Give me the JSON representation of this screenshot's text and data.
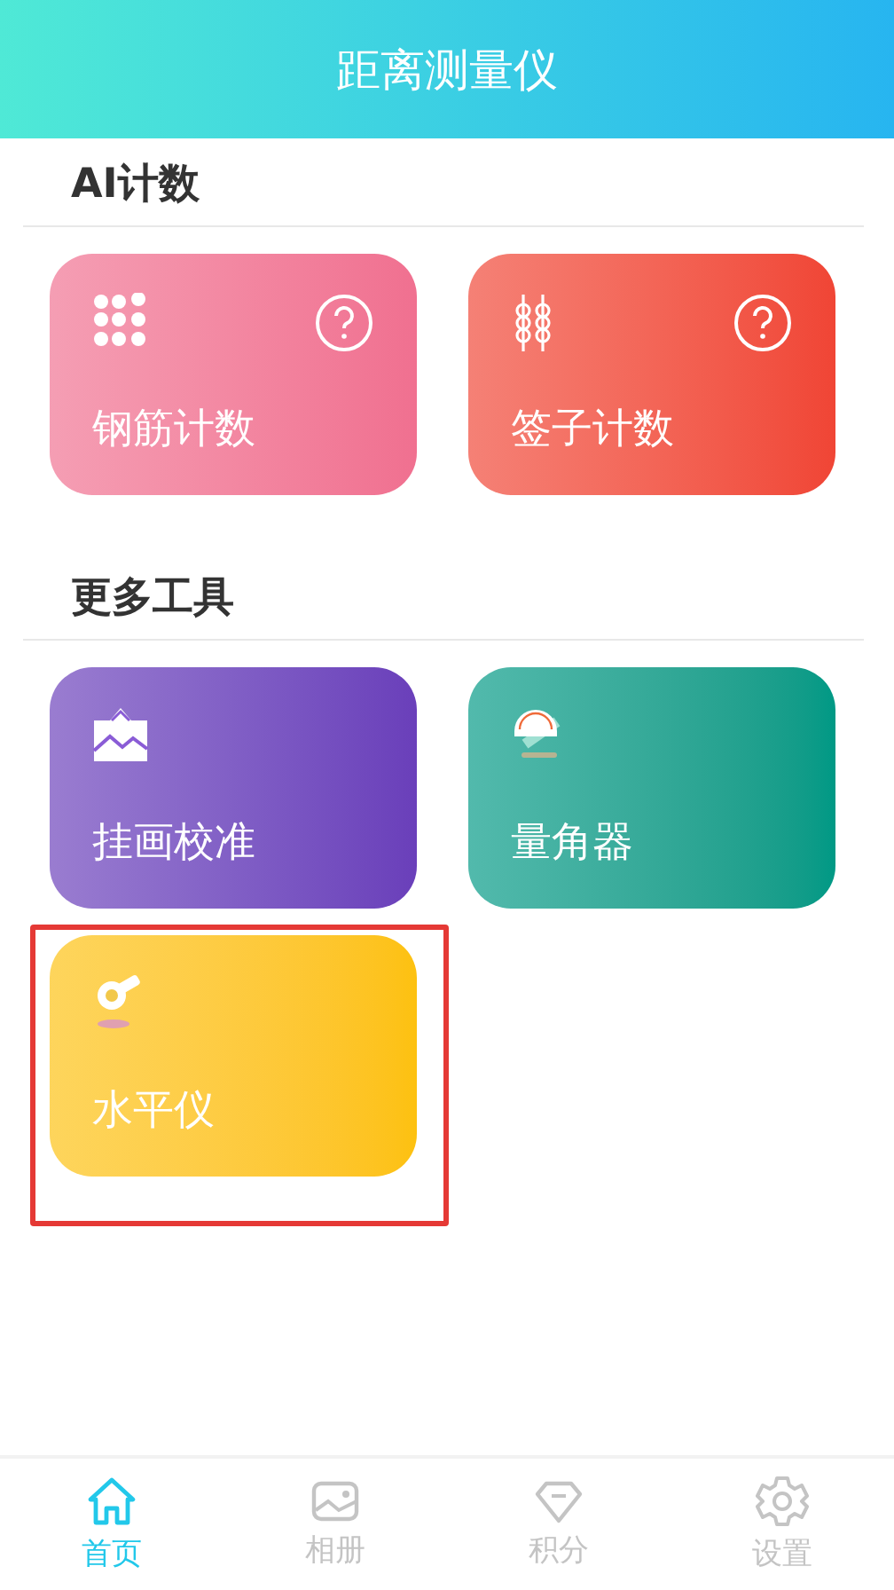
{
  "header": {
    "title": "距离测量仪"
  },
  "sections": [
    {
      "title": "AI计数",
      "tools": [
        {
          "label": "钢筋计数",
          "kind": "dots",
          "help": true,
          "color": "#f07090",
          "highlighted": false
        },
        {
          "label": "签子计数",
          "kind": "skewers",
          "help": true,
          "color": "#f04535",
          "highlighted": false
        }
      ]
    },
    {
      "title": "更多工具",
      "tools": [
        {
          "label": "挂画校准",
          "kind": "frame",
          "help": false,
          "color": "#6a3fba",
          "highlighted": false
        },
        {
          "label": "量角器",
          "kind": "protractor",
          "help": false,
          "color": "#009985",
          "highlighted": false
        },
        {
          "label": "水平仪",
          "kind": "level",
          "help": false,
          "color": "#fdc10f",
          "highlighted": true
        }
      ]
    }
  ],
  "tabs": [
    {
      "label": "首页",
      "kind": "home",
      "selected": true
    },
    {
      "label": "相册",
      "kind": "album",
      "selected": false
    },
    {
      "label": "积分",
      "kind": "gem",
      "selected": false
    },
    {
      "label": "设置",
      "kind": "gear",
      "selected": false
    }
  ]
}
